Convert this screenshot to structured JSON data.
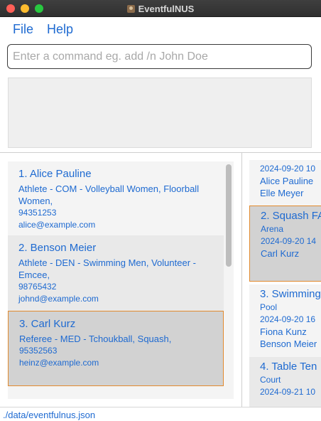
{
  "window": {
    "title": "EventfulNUS"
  },
  "menu": {
    "file": "File",
    "help": "Help"
  },
  "command": {
    "placeholder": "Enter a command eg. add /n John Doe",
    "value": ""
  },
  "result": {
    "text": ""
  },
  "persons": [
    {
      "name": "1. Alice Pauline",
      "tags": "Athlete - COM - Volleyball Women, Floorball Women,",
      "phone": "94351253",
      "email": "alice@example.com"
    },
    {
      "name": "2. Benson Meier",
      "tags": "Athlete - DEN - Swimming Men, Volunteer - Emcee,",
      "phone": "98765432",
      "email": "johnd@example.com"
    },
    {
      "name": "3. Carl Kurz",
      "tags": "Referee - MED - Tchoukball, Squash,",
      "phone": "95352563",
      "email": "heinz@example.com"
    }
  ],
  "events": [
    {
      "time": "2024-09-20 10",
      "participants": [
        "Alice Pauline",
        "Elle Meyer"
      ]
    },
    {
      "name": "2. Squash FA",
      "venue": "Arena",
      "time": "2024-09-20 14",
      "participants": [
        "Carl Kurz"
      ]
    },
    {
      "name": "3. Swimming",
      "venue": "Pool",
      "time": "2024-09-20 16",
      "participants": [
        "Fiona Kunz",
        "Benson Meier"
      ]
    },
    {
      "name": "4. Table Ten",
      "venue": "Court",
      "time": "2024-09-21 10"
    }
  ],
  "status": {
    "path": "./data/eventfulnus.json"
  },
  "colors": {
    "accent": "#1e6ad1",
    "selected_border": "#e28a2e",
    "selected_bg": "#d2d2d2"
  }
}
